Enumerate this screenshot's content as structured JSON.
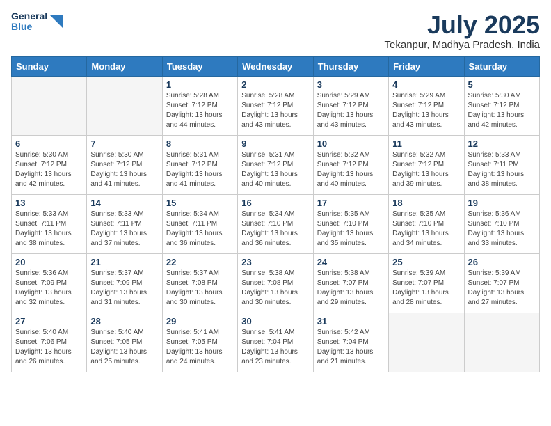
{
  "header": {
    "logo_line1": "General",
    "logo_line2": "Blue",
    "month": "July 2025",
    "location": "Tekanpur, Madhya Pradesh, India"
  },
  "days_of_week": [
    "Sunday",
    "Monday",
    "Tuesday",
    "Wednesday",
    "Thursday",
    "Friday",
    "Saturday"
  ],
  "weeks": [
    [
      {
        "day": "",
        "detail": ""
      },
      {
        "day": "",
        "detail": ""
      },
      {
        "day": "1",
        "detail": "Sunrise: 5:28 AM\nSunset: 7:12 PM\nDaylight: 13 hours\nand 44 minutes."
      },
      {
        "day": "2",
        "detail": "Sunrise: 5:28 AM\nSunset: 7:12 PM\nDaylight: 13 hours\nand 43 minutes."
      },
      {
        "day": "3",
        "detail": "Sunrise: 5:29 AM\nSunset: 7:12 PM\nDaylight: 13 hours\nand 43 minutes."
      },
      {
        "day": "4",
        "detail": "Sunrise: 5:29 AM\nSunset: 7:12 PM\nDaylight: 13 hours\nand 43 minutes."
      },
      {
        "day": "5",
        "detail": "Sunrise: 5:30 AM\nSunset: 7:12 PM\nDaylight: 13 hours\nand 42 minutes."
      }
    ],
    [
      {
        "day": "6",
        "detail": "Sunrise: 5:30 AM\nSunset: 7:12 PM\nDaylight: 13 hours\nand 42 minutes."
      },
      {
        "day": "7",
        "detail": "Sunrise: 5:30 AM\nSunset: 7:12 PM\nDaylight: 13 hours\nand 41 minutes."
      },
      {
        "day": "8",
        "detail": "Sunrise: 5:31 AM\nSunset: 7:12 PM\nDaylight: 13 hours\nand 41 minutes."
      },
      {
        "day": "9",
        "detail": "Sunrise: 5:31 AM\nSunset: 7:12 PM\nDaylight: 13 hours\nand 40 minutes."
      },
      {
        "day": "10",
        "detail": "Sunrise: 5:32 AM\nSunset: 7:12 PM\nDaylight: 13 hours\nand 40 minutes."
      },
      {
        "day": "11",
        "detail": "Sunrise: 5:32 AM\nSunset: 7:12 PM\nDaylight: 13 hours\nand 39 minutes."
      },
      {
        "day": "12",
        "detail": "Sunrise: 5:33 AM\nSunset: 7:11 PM\nDaylight: 13 hours\nand 38 minutes."
      }
    ],
    [
      {
        "day": "13",
        "detail": "Sunrise: 5:33 AM\nSunset: 7:11 PM\nDaylight: 13 hours\nand 38 minutes."
      },
      {
        "day": "14",
        "detail": "Sunrise: 5:33 AM\nSunset: 7:11 PM\nDaylight: 13 hours\nand 37 minutes."
      },
      {
        "day": "15",
        "detail": "Sunrise: 5:34 AM\nSunset: 7:11 PM\nDaylight: 13 hours\nand 36 minutes."
      },
      {
        "day": "16",
        "detail": "Sunrise: 5:34 AM\nSunset: 7:10 PM\nDaylight: 13 hours\nand 36 minutes."
      },
      {
        "day": "17",
        "detail": "Sunrise: 5:35 AM\nSunset: 7:10 PM\nDaylight: 13 hours\nand 35 minutes."
      },
      {
        "day": "18",
        "detail": "Sunrise: 5:35 AM\nSunset: 7:10 PM\nDaylight: 13 hours\nand 34 minutes."
      },
      {
        "day": "19",
        "detail": "Sunrise: 5:36 AM\nSunset: 7:10 PM\nDaylight: 13 hours\nand 33 minutes."
      }
    ],
    [
      {
        "day": "20",
        "detail": "Sunrise: 5:36 AM\nSunset: 7:09 PM\nDaylight: 13 hours\nand 32 minutes."
      },
      {
        "day": "21",
        "detail": "Sunrise: 5:37 AM\nSunset: 7:09 PM\nDaylight: 13 hours\nand 31 minutes."
      },
      {
        "day": "22",
        "detail": "Sunrise: 5:37 AM\nSunset: 7:08 PM\nDaylight: 13 hours\nand 30 minutes."
      },
      {
        "day": "23",
        "detail": "Sunrise: 5:38 AM\nSunset: 7:08 PM\nDaylight: 13 hours\nand 30 minutes."
      },
      {
        "day": "24",
        "detail": "Sunrise: 5:38 AM\nSunset: 7:07 PM\nDaylight: 13 hours\nand 29 minutes."
      },
      {
        "day": "25",
        "detail": "Sunrise: 5:39 AM\nSunset: 7:07 PM\nDaylight: 13 hours\nand 28 minutes."
      },
      {
        "day": "26",
        "detail": "Sunrise: 5:39 AM\nSunset: 7:07 PM\nDaylight: 13 hours\nand 27 minutes."
      }
    ],
    [
      {
        "day": "27",
        "detail": "Sunrise: 5:40 AM\nSunset: 7:06 PM\nDaylight: 13 hours\nand 26 minutes."
      },
      {
        "day": "28",
        "detail": "Sunrise: 5:40 AM\nSunset: 7:05 PM\nDaylight: 13 hours\nand 25 minutes."
      },
      {
        "day": "29",
        "detail": "Sunrise: 5:41 AM\nSunset: 7:05 PM\nDaylight: 13 hours\nand 24 minutes."
      },
      {
        "day": "30",
        "detail": "Sunrise: 5:41 AM\nSunset: 7:04 PM\nDaylight: 13 hours\nand 23 minutes."
      },
      {
        "day": "31",
        "detail": "Sunrise: 5:42 AM\nSunset: 7:04 PM\nDaylight: 13 hours\nand 21 minutes."
      },
      {
        "day": "",
        "detail": ""
      },
      {
        "day": "",
        "detail": ""
      }
    ]
  ]
}
